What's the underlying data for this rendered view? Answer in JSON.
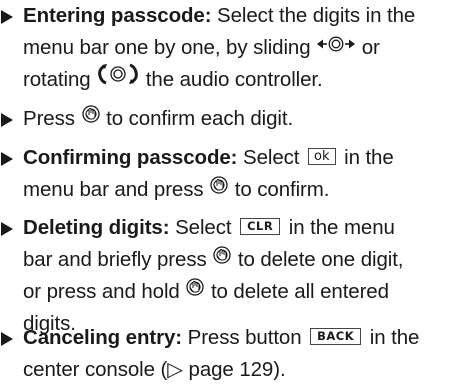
{
  "items": [
    {
      "lines": [
        {
          "bold": "Entering passcode:",
          "text": " Select the digits in the"
        },
        {
          "text": "menu bar one by one, by sliding",
          "after_icon": "or"
        },
        {
          "text": "rotating",
          "after_icon": "the audio controller."
        }
      ],
      "icons": [
        "slide-controller-icon",
        "rotate-controller-icon"
      ]
    },
    {
      "lines": [
        {
          "before": "Press",
          "after": "to confirm each digit."
        }
      ],
      "icons": [
        "press-controller-icon"
      ]
    },
    {
      "lines": [
        {
          "bold": "Confirming passcode:",
          "before": " Select",
          "key": "ok",
          "after": "in the"
        },
        {
          "before": "menu bar and press",
          "after": "to confirm."
        }
      ],
      "icons": [
        "ok-key-icon",
        "press-controller-icon"
      ]
    },
    {
      "lines": [
        {
          "bold": "Deleting digits:",
          "before": " Select",
          "key": "CLR",
          "after": "in the menu"
        },
        {
          "before": "bar and briefly press",
          "after": "to delete one digit,"
        },
        {
          "before": "or press and hold",
          "after": "to delete all entered"
        },
        {
          "text": "digits."
        }
      ],
      "icons": [
        "clr-key-icon",
        "press-controller-icon"
      ]
    },
    {
      "lines": [
        {
          "bold": "Canceling entry:",
          "before": " Press button",
          "key": "BACK",
          "after": "in the"
        },
        {
          "text": "center console (▷ page 129)."
        }
      ],
      "icons": [
        "back-key-icon"
      ]
    }
  ]
}
